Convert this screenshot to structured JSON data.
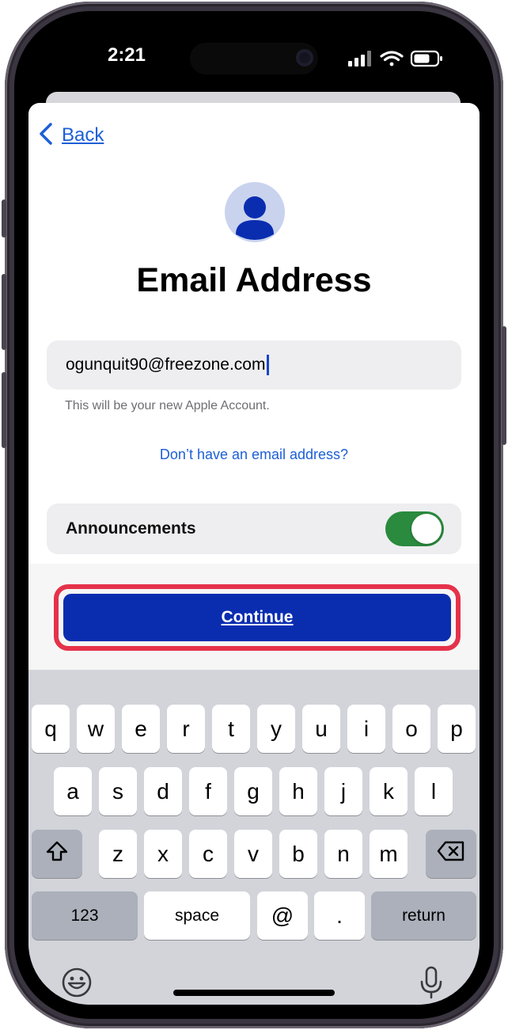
{
  "status_bar": {
    "time": "2:21",
    "icons": [
      "cellular-signal-icon",
      "wifi-icon",
      "battery-icon"
    ]
  },
  "sheet": {
    "back_label": "Back",
    "title": "Email Address",
    "email_value": "ogunquit90@freezone.com",
    "email_hint": "This will be your new Apple Account.",
    "no_email_link": "Don’t have an email address?",
    "announcements_label": "Announcements",
    "announcements_on": true,
    "continue_label": "Continue"
  },
  "keyboard": {
    "row1": [
      "q",
      "w",
      "e",
      "r",
      "t",
      "y",
      "u",
      "i",
      "o",
      "p"
    ],
    "row2": [
      "a",
      "s",
      "d",
      "f",
      "g",
      "h",
      "j",
      "k",
      "l"
    ],
    "row3": [
      "z",
      "x",
      "c",
      "v",
      "b",
      "n",
      "m"
    ],
    "numbers_label": "123",
    "space_label": "space",
    "at_label": "@",
    "dot_label": ".",
    "return_label": "return"
  },
  "colors": {
    "accent_link": "#1d5fd6",
    "continue_button": "#0a2db0",
    "highlight": "#e5324a",
    "toggle_on": "#2a8a3e"
  }
}
